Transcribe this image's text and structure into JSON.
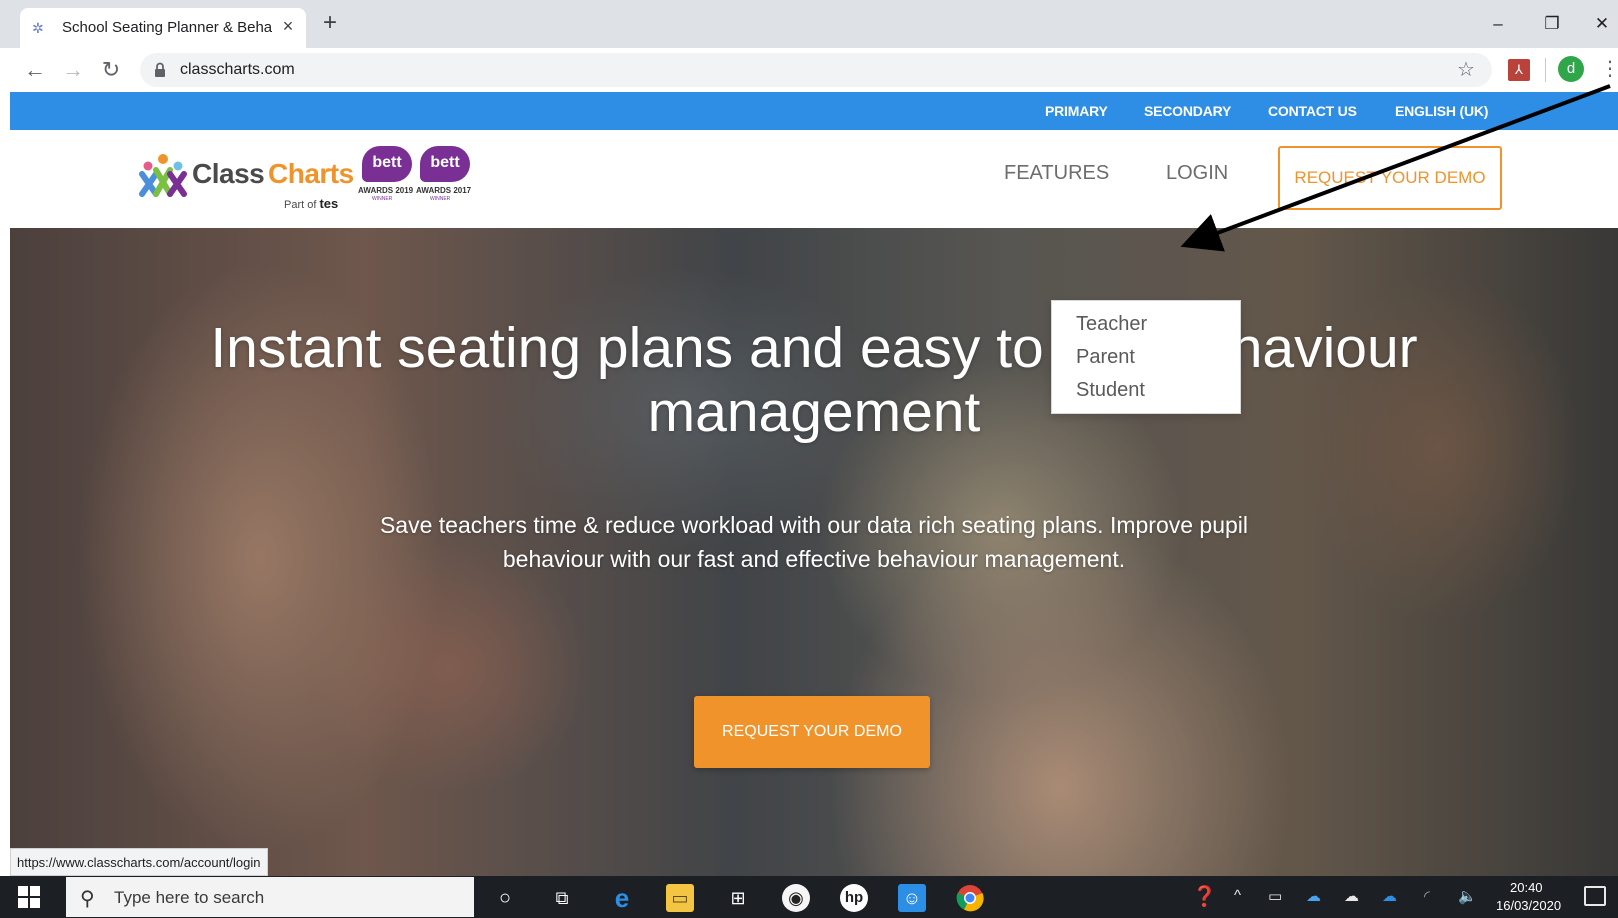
{
  "browser": {
    "tab_title": "School Seating Planner & Behavi",
    "tab_close": "×",
    "new_tab": "+",
    "url": "classcharts.com",
    "profile_initial": "d",
    "status_url": "https://www.classcharts.com/account/login"
  },
  "topbar": {
    "links": [
      "PRIMARY",
      "SECONDARY",
      "CONTACT US",
      "ENGLISH (UK)"
    ],
    "color": "#2e8ee6"
  },
  "header": {
    "logo_class": "Class",
    "logo_charts": "Charts",
    "logo_partof": "Part of",
    "logo_tes": "tes",
    "awards": [
      {
        "badge": "bett",
        "text": "AWARDS 2019",
        "sub": "WINNER"
      },
      {
        "badge": "bett",
        "text": "AWARDS 2017",
        "sub": "WINNER"
      }
    ],
    "nav_features": "FEATURES",
    "nav_login": "LOGIN",
    "demo_button": "REQUEST YOUR DEMO"
  },
  "login_dropdown": {
    "items": [
      "Teacher",
      "Parent",
      "Student"
    ]
  },
  "hero": {
    "title": "Instant seating plans and easy to use behaviour management",
    "subtitle": "Save teachers time & reduce workload with our data rich seating plans. Improve pupil behaviour with our fast and effective behaviour management.",
    "cta": "REQUEST YOUR DEMO",
    "accent": "#f0932b"
  },
  "taskbar": {
    "search_placeholder": "Type here to search",
    "time": "20:40",
    "date": "16/03/2020"
  }
}
